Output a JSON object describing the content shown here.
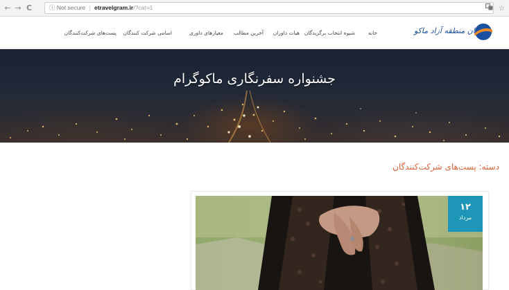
{
  "browser": {
    "back_icon": "←",
    "forward_icon": "→",
    "reload_icon": "C",
    "info_icon": "ⓘ",
    "security_label": "Not secure",
    "separator": "|",
    "host": "etravelgram.ir",
    "path": "/?cat=1",
    "translate_icon": "translate-icon",
    "star_icon": "☆"
  },
  "logo": {
    "text": "سازمان منطقه آزاد ماکو"
  },
  "nav": {
    "items": [
      "خانه",
      "شیوه انتخاب برگزیدگان",
      "هیات داوران",
      "آخرین مطالب",
      "معیارهای داوری",
      "اسامی شرکت کنندگان",
      "پست‌های شرکت‌کنندگان"
    ]
  },
  "hero": {
    "title": "جشنواره سفرنگاری ماکوگرام"
  },
  "category": {
    "heading": "دسته: پست‌های شرکت‌کنندگان"
  },
  "post": {
    "date_day": "۱۲",
    "date_month": "مرداد"
  },
  "colors": {
    "accent_orange": "#e0603a",
    "badge_blue": "#1e96b8",
    "logo_blue": "#1b4fa0",
    "logo_orange": "#f08a24"
  }
}
